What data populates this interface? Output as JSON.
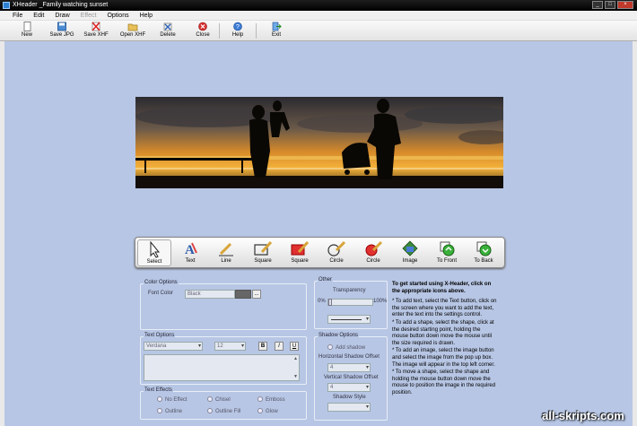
{
  "window": {
    "title": "XHeader _Family watching sunset"
  },
  "menu": [
    "File",
    "Edit",
    "Draw",
    "Effect",
    "Options",
    "Help"
  ],
  "toolbar": {
    "new": "New",
    "save_jpg": "Save JPG",
    "save_xhf": "Save XHF",
    "open_xhf": "Open XHF",
    "delete": "Delete",
    "close": "Close",
    "help": "Help",
    "exit": "Exit"
  },
  "shape_tools": [
    "Select",
    "Text",
    "Line",
    "Square",
    "Square",
    "Circle",
    "Circle",
    "Image",
    "To Front",
    "To Back"
  ],
  "color_options": {
    "title": "Color Options",
    "font_color_label": "Font Color",
    "font_color_value": "Black",
    "browse_label": "..."
  },
  "text_options": {
    "title": "Text Options",
    "font_value": "Verdana",
    "size_value": "12",
    "bold": "B",
    "italic": "I",
    "underline": "U"
  },
  "text_effects": {
    "title": "Text Effects",
    "options": [
      "No Effect",
      "Chisel",
      "Emboss",
      "Outline",
      "Outline Fill",
      "Glow"
    ]
  },
  "other": {
    "title": "Other",
    "transparency_label": "Transparency",
    "min": "0%",
    "max": "100%"
  },
  "shadow_options": {
    "title": "Shadow Options",
    "add_shadow": "Add shadow",
    "horizontal_label": "Horizontal Shadow Offset",
    "horizontal_value": "4",
    "vertical_label": "Vertical Shadow Offset",
    "vertical_value": "4",
    "style_label": "Shadow Style"
  },
  "help": {
    "intro": "To get started using X-Header, click on the appropriate icons above.",
    "items": [
      "* To add text, select the Text button, click on the screen where you want to add the text, enter the text into the settings control.",
      "* To add a shape, select the shape, click at the desired starting point, holding the mouse button down move the mouse until the size required is drawn.",
      "* To add an image, select the image button and select the image from the pop up box. The image will appear in the top left corner.",
      "* To move a shape, select the shape and holding the mouse button down move the mouse to position the image in the required position."
    ]
  },
  "watermark": "all-skripts.com",
  "colors": {
    "background": "#b7c6e4",
    "titlebar": "#000000",
    "toolbar": "#e8e8e8"
  }
}
